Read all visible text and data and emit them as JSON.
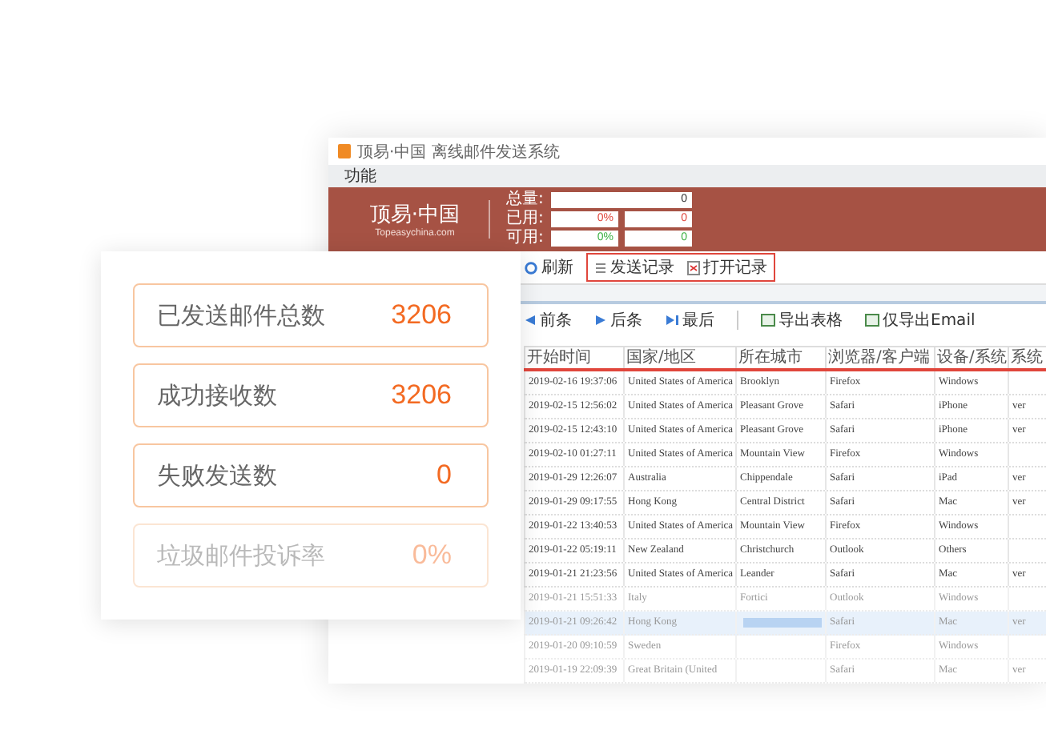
{
  "window": {
    "title": "顶易·中国 离线邮件发送系统",
    "menu": [
      "功能"
    ],
    "banner": {
      "logo": "顶易·中国",
      "logo_url": "Topeasychina.com",
      "rows": [
        {
          "label": "总量:",
          "fields": [
            {
              "value": "0",
              "color": "#333333"
            }
          ]
        },
        {
          "label": "已用:",
          "fields": [
            {
              "value": "0%",
              "color": "#e0463c"
            },
            {
              "value": "0",
              "color": "#e0463c"
            }
          ]
        },
        {
          "label": "可用:",
          "fields": [
            {
              "value": "0%",
              "color": "#3cb043"
            },
            {
              "value": "0",
              "color": "#3cb043"
            }
          ]
        }
      ]
    },
    "toolbar": {
      "items": [
        {
          "label": "刷新",
          "kind": "refresh"
        }
      ],
      "highlighted_items": [
        {
          "label": "发送记录",
          "kind": "list"
        },
        {
          "label": "打开记录",
          "kind": "open"
        }
      ]
    },
    "nav_toolbar": [
      {
        "label": "前条",
        "kind": "prev"
      },
      {
        "label": "后条",
        "kind": "next"
      },
      {
        "label": "最后",
        "kind": "last"
      },
      {
        "label": "导出表格",
        "kind": "export"
      },
      {
        "label": "仅导出Email",
        "kind": "export"
      }
    ],
    "table": {
      "columns": [
        "开始时间",
        "国家/地区",
        "所在城市",
        "浏览器/客户端",
        "设备/系统",
        "系统"
      ],
      "rows": [
        {
          "cells": [
            "2019-02-16 19:37:06",
            "United States of America",
            "Brooklyn",
            "Firefox",
            "Windows",
            ""
          ],
          "selected": false,
          "faded": false
        },
        {
          "cells": [
            "2019-02-15 12:56:02",
            "United States of America",
            "Pleasant Grove",
            "Safari",
            "iPhone",
            "ver"
          ],
          "selected": false,
          "faded": false
        },
        {
          "cells": [
            "2019-02-15 12:43:10",
            "United States of America",
            "Pleasant Grove",
            "Safari",
            "iPhone",
            "ver"
          ],
          "selected": false,
          "faded": false
        },
        {
          "cells": [
            "2019-02-10 01:27:11",
            "United States of America",
            "Mountain View",
            "Firefox",
            "Windows",
            ""
          ],
          "selected": false,
          "faded": false
        },
        {
          "cells": [
            "2019-01-29 12:26:07",
            "Australia",
            "Chippendale",
            "Safari",
            "iPad",
            "ver"
          ],
          "selected": false,
          "faded": false
        },
        {
          "cells": [
            "2019-01-29 09:17:55",
            "Hong Kong",
            "Central District",
            "Safari",
            "Mac",
            "ver"
          ],
          "selected": false,
          "faded": false
        },
        {
          "cells": [
            "2019-01-22 13:40:53",
            "United States of America",
            "Mountain View",
            "Firefox",
            "Windows",
            ""
          ],
          "selected": false,
          "faded": false
        },
        {
          "cells": [
            "2019-01-22 05:19:11",
            "New Zealand",
            "Christchurch",
            "Outlook",
            "Others",
            ""
          ],
          "selected": false,
          "faded": false
        },
        {
          "cells": [
            "2019-01-21 21:23:56",
            "United States of America",
            "Leander",
            "Safari",
            "Mac",
            "ver"
          ],
          "selected": false,
          "faded": false
        },
        {
          "cells": [
            "2019-01-21 15:51:33",
            "Italy",
            "Fortici",
            "Outlook",
            "Windows",
            ""
          ],
          "selected": false,
          "faded": true
        },
        {
          "cells": [
            "2019-01-21 09:26:42",
            "Hong Kong",
            "",
            "Safari",
            "Mac",
            "ver"
          ],
          "selected": true,
          "faded": true
        },
        {
          "cells": [
            "2019-01-20 09:10:59",
            "Sweden",
            "",
            "Firefox",
            "Windows",
            ""
          ],
          "selected": false,
          "faded": true
        },
        {
          "cells": [
            "2019-01-19 22:09:39",
            "Great Britain (United",
            "",
            "Safari",
            "Mac",
            "ver"
          ],
          "selected": false,
          "faded": true
        }
      ]
    }
  },
  "stats": [
    {
      "label": "已发送邮件总数",
      "value": "3206",
      "faded": false
    },
    {
      "label": "成功接收数",
      "value": "3206",
      "faded": false
    },
    {
      "label": "失败发送数",
      "value": "0",
      "faded": false
    },
    {
      "label": "垃圾邮件投诉率",
      "value": "0%",
      "faded": true
    }
  ]
}
